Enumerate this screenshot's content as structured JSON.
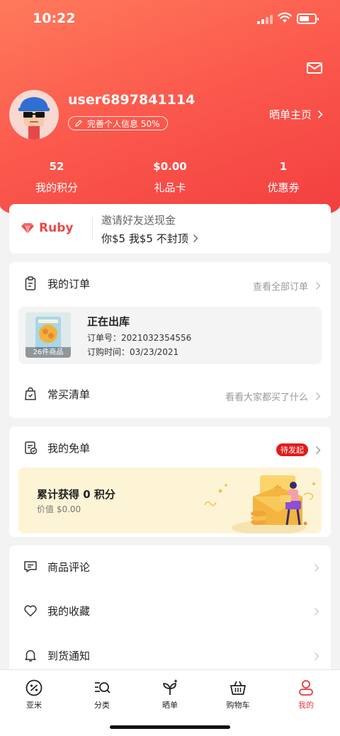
{
  "status_bar": {
    "time": "10:22"
  },
  "profile": {
    "username": "user6897841114",
    "completion_label": "完善个人信息 50%",
    "share_home_label": "晒单主页"
  },
  "stats": [
    {
      "value": "52",
      "label": "我的积分"
    },
    {
      "value": "$0.00",
      "label": "礼品卡"
    },
    {
      "value": "1",
      "label": "优惠券"
    }
  ],
  "ruby": {
    "brand": "Ruby",
    "title": "邀请好友送现金",
    "subtitle": "你$5 我$5 不封顶"
  },
  "orders": {
    "title": "我的订单",
    "view_all": "查看全部订单",
    "order": {
      "status": "正在出库",
      "number_line": "订单号：2021032354556",
      "time_line": "订购时间：03/23/2021",
      "item_count": "26件商品"
    },
    "frequent_title": "常买清单",
    "frequent_link": "看看大家都买了什么"
  },
  "free_order": {
    "title": "我的免单",
    "badge": "待发起",
    "earned": "累计获得 0 积分",
    "value": "价值 $0.00"
  },
  "menu": [
    {
      "label": "商品评论",
      "icon": "comment-icon"
    },
    {
      "label": "我的收藏",
      "icon": "heart-icon"
    },
    {
      "label": "到货通知",
      "icon": "bell-icon"
    }
  ],
  "tabbar": [
    {
      "label": "亚米",
      "icon": "yami-home-icon"
    },
    {
      "label": "分类",
      "icon": "category-search-icon"
    },
    {
      "label": "晒单",
      "icon": "sprout-icon"
    },
    {
      "label": "购物车",
      "icon": "basket-icon"
    },
    {
      "label": "我的",
      "icon": "user-icon",
      "active": true
    }
  ],
  "colors": {
    "accent": "#e8383b",
    "header_start": "#ff7a5c",
    "header_end": "#f23d3f",
    "badge": "#e21b1b",
    "free_box_bg": "#fdf4d6"
  }
}
